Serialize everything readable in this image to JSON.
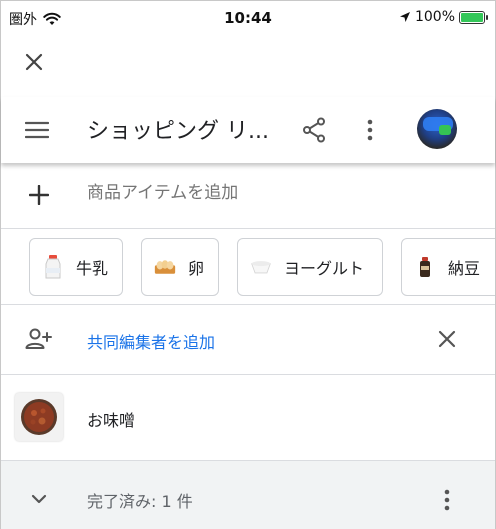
{
  "status_bar": {
    "carrier": "圏外",
    "time": "10:44",
    "battery_percent": "100%",
    "battery_level": 1.0
  },
  "header": {
    "title": "ショッピング リ...",
    "icons": [
      "menu-icon",
      "share-icon",
      "more-vert-icon",
      "avatar"
    ]
  },
  "add_item": {
    "placeholder": "商品アイテムを追加"
  },
  "suggestions": [
    {
      "label": "牛乳",
      "icon": "milk-icon"
    },
    {
      "label": "卵",
      "icon": "eggs-icon"
    },
    {
      "label": "ヨーグルト",
      "icon": "yogurt-icon"
    },
    {
      "label": "納豆",
      "icon": "natto-icon"
    }
  ],
  "collaborator": {
    "label": "共同編集者を追加"
  },
  "items": [
    {
      "label": "お味噌"
    }
  ],
  "completed": {
    "label": "完了済み: 1 件"
  },
  "colors": {
    "link": "#1a73e8",
    "battery": "#34c759",
    "completed_bg": "#f1f3f4"
  }
}
